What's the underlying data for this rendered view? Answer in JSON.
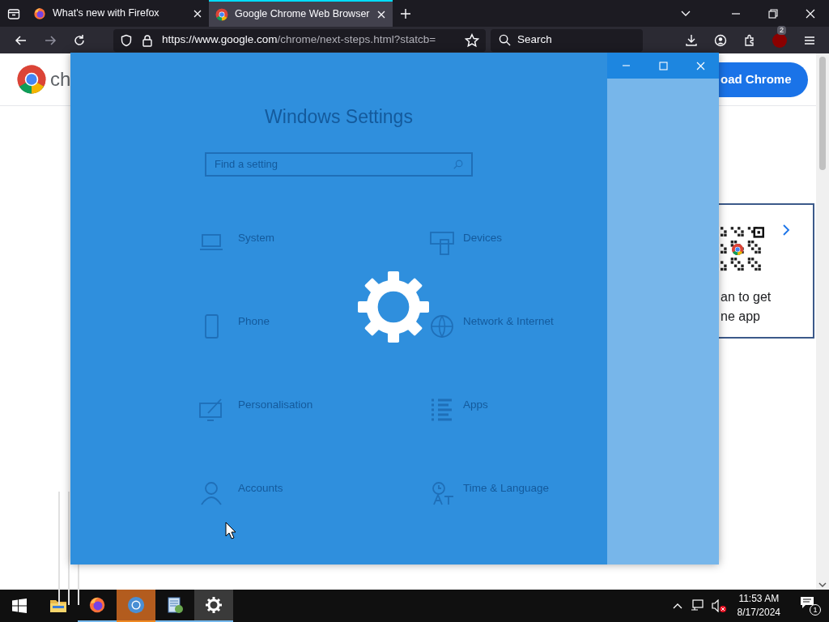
{
  "browser": {
    "tabs": [
      {
        "title": "What's new with Firefox",
        "selected": false
      },
      {
        "title": "Google Chrome Web Browser",
        "selected": true
      }
    ],
    "url_host": "https://www.google.com",
    "url_path": "/chrome/next-steps.html?statcb=",
    "search_placeholder": "Search",
    "extension_badge": "2"
  },
  "page": {
    "logo_text": "ch",
    "download_button": "oad Chrome",
    "qr_card_lines": [
      "an to get",
      "ne app"
    ]
  },
  "settings_window": {
    "title": "Windows Settings",
    "search_placeholder": "Find a setting",
    "categories": [
      {
        "kind": "laptop",
        "title": "System"
      },
      {
        "kind": "devices",
        "title": "Devices"
      },
      {
        "kind": "phone",
        "title": "Phone"
      },
      {
        "kind": "globe",
        "title": "Network & Internet"
      },
      {
        "kind": "paint",
        "title": "Personalisation"
      },
      {
        "kind": "apps",
        "title": "Apps"
      },
      {
        "kind": "person",
        "title": "Accounts"
      },
      {
        "kind": "time",
        "title": "Time & Language"
      }
    ]
  },
  "taskbar": {
    "apps": [
      {
        "kind": "folder",
        "running": false,
        "flashing": false,
        "active": false
      },
      {
        "kind": "firefox",
        "running": true,
        "flashing": false,
        "active": false
      },
      {
        "kind": "chrome",
        "running": true,
        "flashing": true,
        "active": false
      },
      {
        "kind": "installer",
        "running": true,
        "flashing": false,
        "active": false
      },
      {
        "kind": "gear",
        "running": true,
        "flashing": false,
        "active": true
      }
    ],
    "time": "11:53 AM",
    "date": "8/17/2024",
    "notification_count": "1"
  }
}
